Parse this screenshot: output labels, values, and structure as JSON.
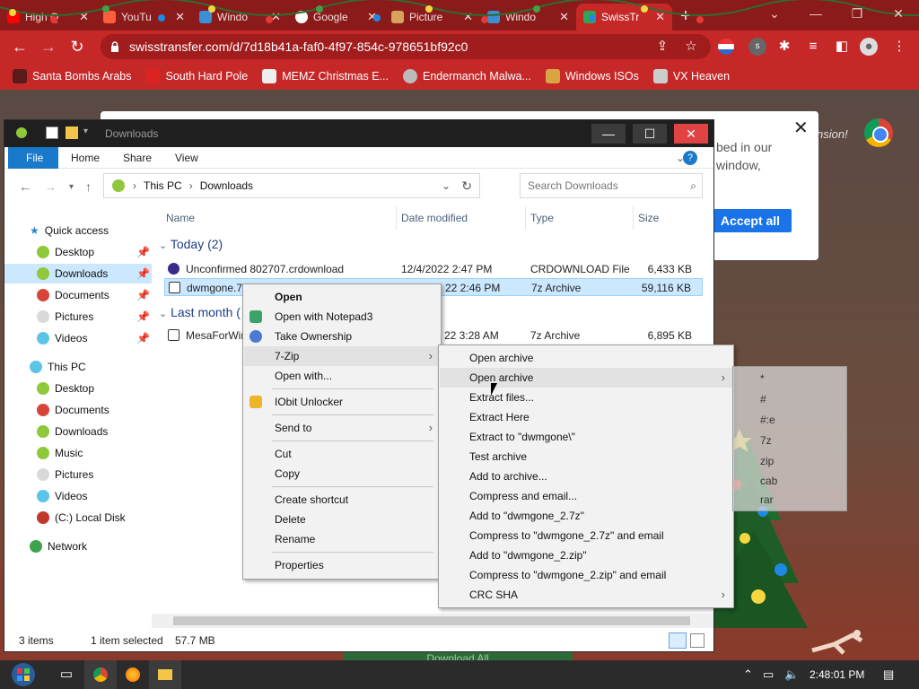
{
  "browser": {
    "tabs": [
      {
        "label": "High Q",
        "color": "#ff0000"
      },
      {
        "label": "YouTu",
        "color": "#ff5e3a"
      },
      {
        "label": "Windo",
        "color": "#3b8fd6"
      },
      {
        "label": "Google",
        "color": "#ffffff"
      },
      {
        "label": "Picture",
        "color": "#d9a25c"
      },
      {
        "label": "Windo",
        "color": "#3b8fd6"
      },
      {
        "label": "SwissTr",
        "color": "#2fa84f"
      }
    ],
    "url": "swisstransfer.com/d/7d18b41a-faf0-4f97-854c-978651bf92c0",
    "bookmarks": [
      "Santa Bombs Arabs",
      "South Hard Pole",
      "MEMZ Christmas E...",
      "Endermanch Malwa...",
      "Windows ISOs",
      "VX Heaven"
    ],
    "page": {
      "cookie_text": "bed in our window,",
      "accept_label": "Accept all",
      "faint_text": "nsion!",
      "download_all": "Download All"
    }
  },
  "explorer": {
    "title": "Downloads",
    "ribbon_tabs": [
      "File",
      "Home",
      "Share",
      "View"
    ],
    "breadcrumb": [
      "This PC",
      "Downloads"
    ],
    "search_placeholder": "Search Downloads",
    "nav": {
      "quick_access": "Quick access",
      "quick_items": [
        "Desktop",
        "Downloads",
        "Documents",
        "Pictures",
        "Videos"
      ],
      "this_pc": "This PC",
      "pc_items": [
        "Desktop",
        "Documents",
        "Downloads",
        "Music",
        "Pictures",
        "Videos",
        "(C:) Local Disk"
      ],
      "network": "Network"
    },
    "columns": [
      "Name",
      "Date modified",
      "Type",
      "Size"
    ],
    "groups": [
      "Today (2)",
      "Last month ("
    ],
    "files": [
      {
        "name": "Unconfirmed 802707.crdownload",
        "date": "12/4/2022 2:47 PM",
        "type": "CRDOWNLOAD File",
        "size": "6,433 KB"
      },
      {
        "name": "dwmgone.7:",
        "date": "22 2:46 PM",
        "type": "7z Archive",
        "size": "59,116 KB"
      },
      {
        "name": "MesaForWin",
        "date": "22 3:28 AM",
        "type": "7z Archive",
        "size": "6,895 KB"
      }
    ],
    "status": {
      "items": "3 items",
      "selected": "1 item selected",
      "size": "57.7 MB"
    }
  },
  "context_menu": {
    "items": [
      "Open",
      "Open with Notepad3",
      "Take Ownership",
      "7-Zip",
      "Open with...",
      "IObit Unlocker",
      "Send to",
      "Cut",
      "Copy",
      "Create shortcut",
      "Delete",
      "Rename",
      "Properties"
    ]
  },
  "zip_menu": {
    "items": [
      "Open archive",
      "Open archive",
      "Extract files...",
      "Extract Here",
      "Extract to \"dwmgone\\\"",
      "Test archive",
      "Add to archive...",
      "Compress and email...",
      "Add to \"dwmgone_2.7z\"",
      "Compress to \"dwmgone_2.7z\" and email",
      "Add to \"dwmgone_2.zip\"",
      "Compress to \"dwmgone_2.zip\" and email",
      "CRC SHA"
    ]
  },
  "ghost_menu": {
    "items": [
      "*",
      "#",
      "#:e",
      "7z",
      "zip",
      "cab",
      "rar"
    ]
  },
  "taskbar": {
    "clock": "2:48:01 PM"
  }
}
